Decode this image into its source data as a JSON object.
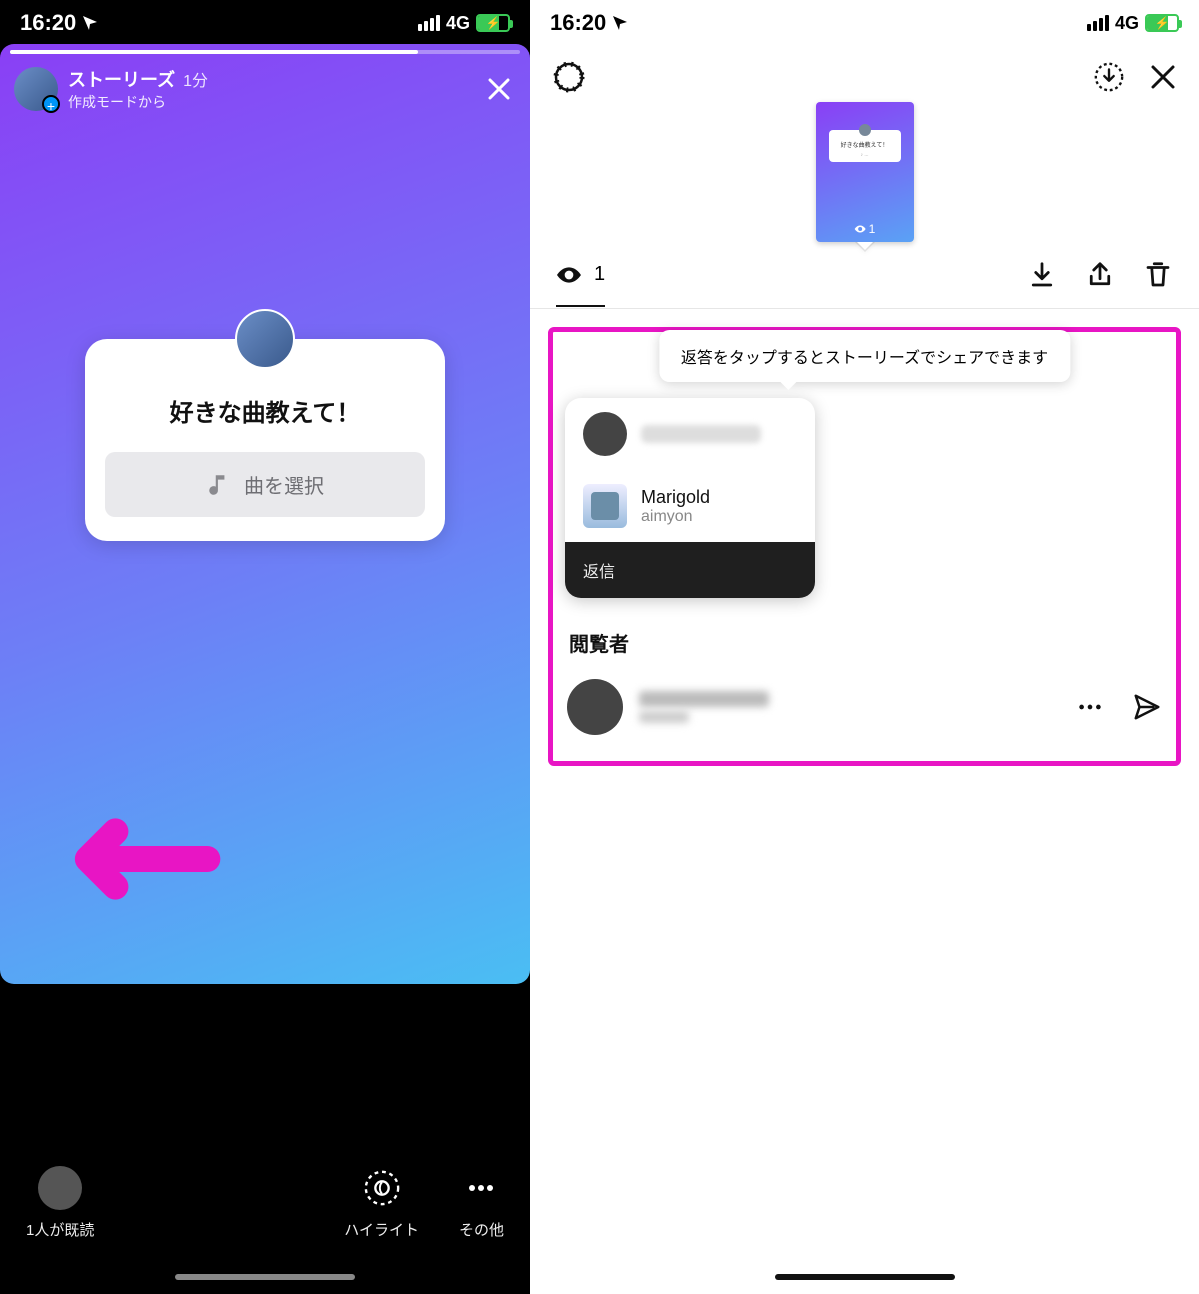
{
  "status": {
    "time": "16:20",
    "network": "4G"
  },
  "left": {
    "header": {
      "title": "ストーリーズ",
      "age": "1分",
      "subtitle": "作成モードから"
    },
    "card": {
      "question": "好きな曲教えて！",
      "select_label": "曲を選択"
    },
    "footer": {
      "seen_label": "1人が既読",
      "highlight_label": "ハイライト",
      "more_label": "その他"
    }
  },
  "right": {
    "thumb": {
      "question": "好きな曲教えて！",
      "views": "1"
    },
    "view_count": "1",
    "tooltip": "返答をタップするとストーリーズでシェアできます",
    "response": {
      "song_title": "Marigold",
      "artist": "aimyon",
      "reply_label": "返信"
    },
    "viewers_header": "閲覧者"
  }
}
